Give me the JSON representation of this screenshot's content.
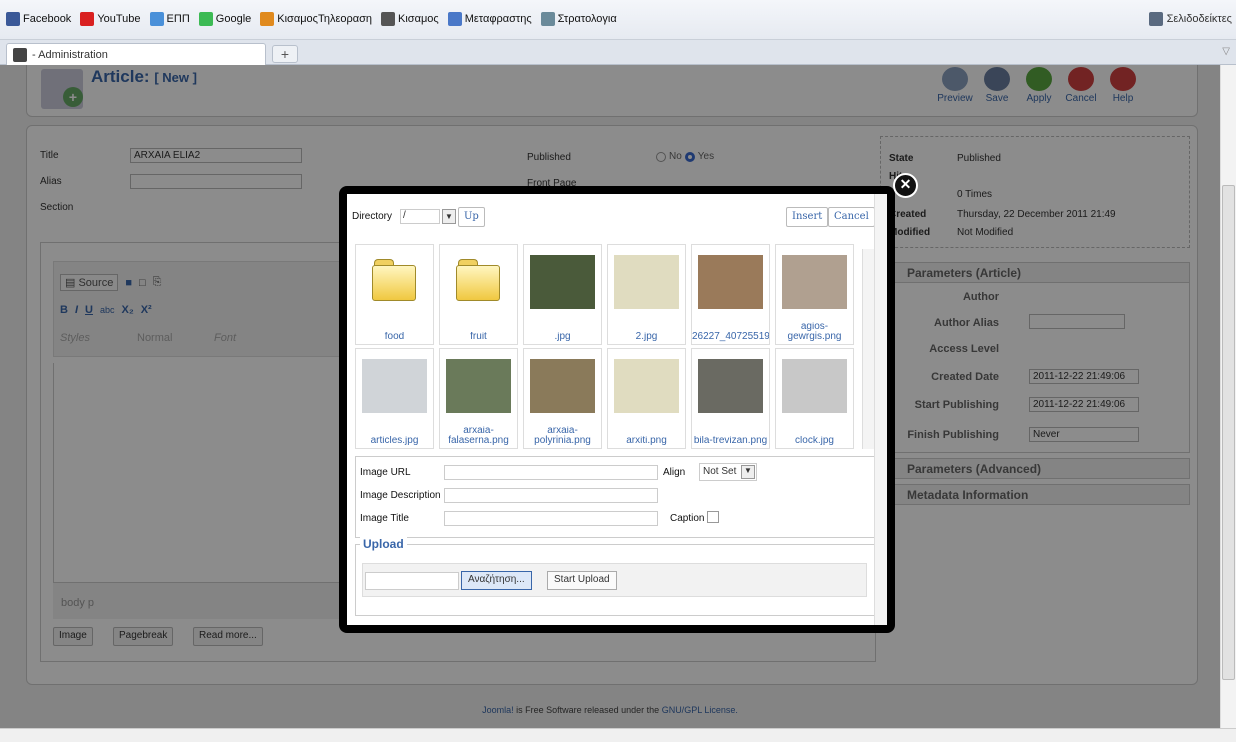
{
  "bookmarks": [
    {
      "label": "Facebook",
      "color": "#3b5998"
    },
    {
      "label": "YouTube",
      "color": "#d92020"
    },
    {
      "label": "ΕΠΠ",
      "color": "#4a90d9"
    },
    {
      "label": "Google",
      "color": "#3cba54"
    },
    {
      "label": "ΚισαμοςΤηλεοραση",
      "color": "#e08a1e"
    },
    {
      "label": "Κισαμος",
      "color": "#555555"
    },
    {
      "label": "Μεταφραστης",
      "color": "#4a78c8"
    },
    {
      "label": "Στρατολογια",
      "color": "#6a8a9a"
    }
  ],
  "bookmarks_folder": "Σελιδοδείκτες",
  "tab": {
    "title": "- Administration",
    "new_tab": "+"
  },
  "header": {
    "title": "Article:",
    "subtitle": "[ New ]",
    "toolbar": [
      {
        "label": "Preview",
        "color": "#8aa0c0"
      },
      {
        "label": "Save",
        "color": "#6a7fa0"
      },
      {
        "label": "Apply",
        "color": "#5aa840"
      },
      {
        "label": "Cancel",
        "color": "#d04040"
      },
      {
        "label": "Help",
        "color": "#d04040"
      }
    ]
  },
  "form": {
    "title_label": "Title",
    "title_value": "ARXAIA ELIA2",
    "alias_label": "Alias",
    "alias_value": "",
    "section_label": "Section",
    "published_label": "Published",
    "frontpage_label": "Front Page",
    "no": "No",
    "yes": "Yes"
  },
  "info": {
    "state_label": "State",
    "state_value": "Published",
    "hits_label": "Hits",
    "hits_value": "0 Times",
    "created_label": "Created",
    "created_value": "Thursday, 22 December 2011 21:49",
    "modified_label": "Modified",
    "modified_value": "Not Modified"
  },
  "params": {
    "header": "Parameters (Article)",
    "author": "Author",
    "author_alias": "Author Alias",
    "access": "Access Level",
    "created_date": "Created Date",
    "created_date_value": "2011-12-22 21:49:06",
    "start_pub": "Start Publishing",
    "start_pub_value": "2011-12-22 21:49:06",
    "finish_pub": "Finish Publishing",
    "finish_pub_value": "Never",
    "advanced": "Parameters (Advanced)",
    "metadata": "Metadata Information"
  },
  "editor": {
    "source": "Source",
    "styles": "Styles",
    "format": "Normal",
    "font": "Font",
    "path": "body  p",
    "image_btn": "Image",
    "pagebreak_btn": "Pagebreak",
    "readmore_btn": "Read more..."
  },
  "modal": {
    "directory_label": "Directory",
    "directory_value": "/",
    "up": "Up",
    "insert": "Insert",
    "cancel": "Cancel",
    "items": [
      {
        "name": "food",
        "kind": "folder"
      },
      {
        "name": "fruit",
        "kind": "folder"
      },
      {
        "name": ".jpg",
        "kind": "image",
        "color": "#4a5a3a"
      },
      {
        "name": "2.jpg",
        "kind": "image",
        "color": "#e0dcc0"
      },
      {
        "name": "26227_40725519",
        "kind": "image",
        "color": "#9a7a5a"
      },
      {
        "name": "agios-gewrgis.png",
        "kind": "image",
        "color": "#b0a090"
      },
      {
        "name": "articles.jpg",
        "kind": "image",
        "color": "#d0d4d8"
      },
      {
        "name": "arxaia-falaserna.png",
        "kind": "image",
        "color": "#6a7a5a"
      },
      {
        "name": "arxaia-polyrinia.png",
        "kind": "image",
        "color": "#8a7a5a"
      },
      {
        "name": "arxiti.png",
        "kind": "image",
        "color": "#e0dcc0"
      },
      {
        "name": "bila-trevizan.png",
        "kind": "image",
        "color": "#6a6a62"
      },
      {
        "name": "clock.jpg",
        "kind": "image",
        "color": "#c8c8c8"
      }
    ],
    "image_url_label": "Image URL",
    "image_desc_label": "Image Description",
    "image_title_label": "Image Title",
    "align_label": "Align",
    "align_value": "Not Set",
    "caption_label": "Caption",
    "upload_legend": "Upload",
    "browse_btn": "Αναζήτηση...",
    "start_upload_btn": "Start Upload"
  },
  "footer": {
    "prefix": "Joomla!",
    "text": " is Free Software released under the ",
    "link": "GNU/GPL License."
  }
}
